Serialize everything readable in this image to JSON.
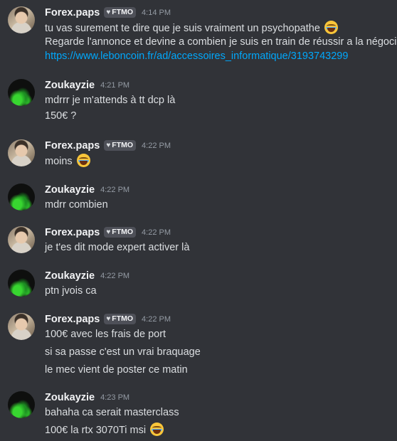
{
  "messages": [
    {
      "author": "Forex.paps",
      "badge": "FTMO",
      "badge_icon": "heart-icon",
      "time": "4:14 PM",
      "lines": [
        "tu vas surement te dire que je suis vraiment un psychopathe",
        "Regarde l'annonce et devine a combien je suis en train de réussir a la négocier",
        "https://www.leboncoin.fr/ad/accessoires_informatique/3193743299"
      ]
    },
    {
      "author": "Zoukayzie",
      "time": "4:21 PM",
      "lines": [
        "mdrrr je m'attends à tt dcp là",
        "150€ ?"
      ]
    },
    {
      "author": "Forex.paps",
      "badge": "FTMO",
      "badge_icon": "heart-icon",
      "time": "4:22 PM",
      "lines": [
        "moins"
      ]
    },
    {
      "author": "Zoukayzie",
      "time": "4:22 PM",
      "lines": [
        "mdrr combien"
      ]
    },
    {
      "author": "Forex.paps",
      "badge": "FTMO",
      "badge_icon": "heart-icon",
      "time": "4:22 PM",
      "lines": [
        "je t'es dit mode expert activer là"
      ]
    },
    {
      "author": "Zoukayzie",
      "time": "4:22 PM",
      "lines": [
        "ptn jvois ca"
      ]
    },
    {
      "author": "Forex.paps",
      "badge": "FTMO",
      "badge_icon": "heart-icon",
      "time": "4:22 PM",
      "lines": [
        "100€ avec les frais de port",
        "si sa passe c'est un vrai braquage",
        "le mec vient de poster ce matin"
      ]
    },
    {
      "author": "Zoukayzie",
      "time": "4:23 PM",
      "lines": [
        "bahaha ca serait masterclass",
        "100€ la rtx 3070Ti msi"
      ]
    }
  ],
  "emoji_name": "joy-emoji",
  "colors": {
    "background": "#313338",
    "username": "#f2f3f5",
    "text": "#dbdee1",
    "timestamp": "#949ba4",
    "link": "#00a8fc",
    "badge_bg": "#4e5058"
  }
}
